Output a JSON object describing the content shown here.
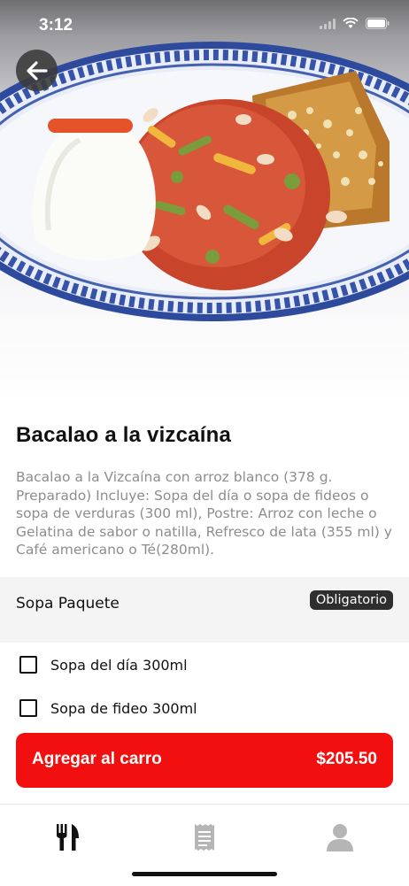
{
  "status_bar": {
    "time": "3:12"
  },
  "hero": {
    "image": "bacalao-plate-photo"
  },
  "product": {
    "title": "Bacalao a la vizcaína",
    "description": "Bacalao a la Vizcaína con arroz blanco (378 g. Preparado) Incluye: Sopa del día o sopa de fideos o sopa de verduras (300 ml), Postre: Arroz con leche o Gelatina de sabor o natilla, Refresco de lata (355 ml) y Café americano o Té(280ml)."
  },
  "section": {
    "title": "Sopa Paquete",
    "badge": "Obligatorio"
  },
  "options": [
    {
      "label": "Sopa del día 300ml",
      "checked": false
    },
    {
      "label": "Sopa de fideo 300ml",
      "checked": false
    }
  ],
  "cart_button": {
    "label": "Agregar al carro",
    "price": "$205.50"
  },
  "tab_bar": {
    "tabs": [
      "menu-icon",
      "receipt-icon",
      "profile-icon"
    ],
    "active": "menu-icon"
  },
  "colors": {
    "accent": "#f20f0f",
    "badge": "#2e2e2e",
    "section_bg": "#f4f4f4"
  }
}
